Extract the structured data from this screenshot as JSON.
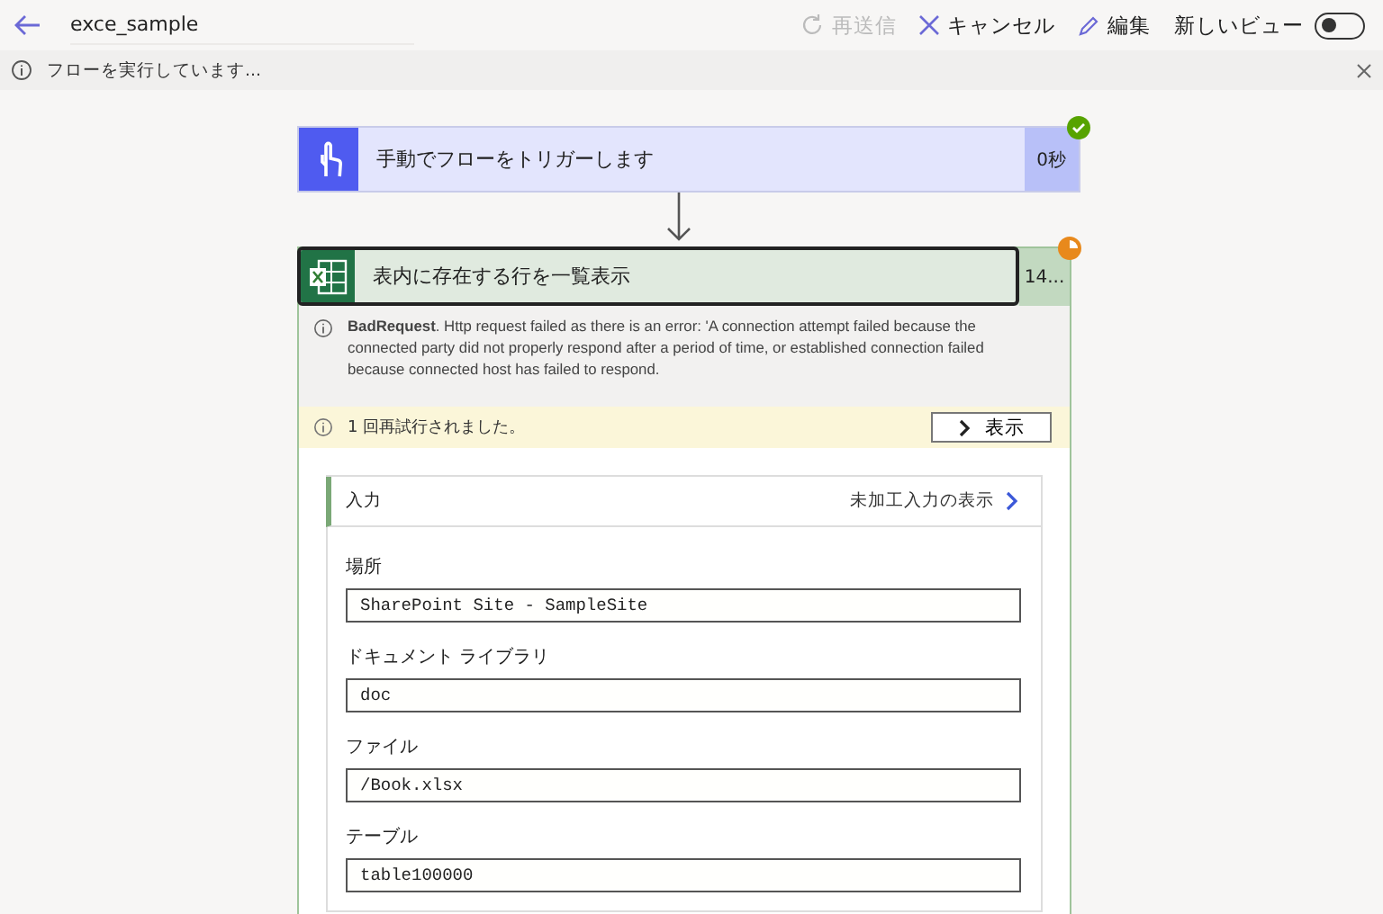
{
  "header": {
    "title": "exce_sample",
    "actions": [
      {
        "kind": "resend",
        "label": "再送信",
        "disabled": true
      },
      {
        "kind": "cancel",
        "label": "キャンセル",
        "disabled": false
      },
      {
        "kind": "edit",
        "label": "編集",
        "disabled": false
      }
    ],
    "new_view": {
      "label": "新しいビュー",
      "on": false
    }
  },
  "banner": {
    "message": "フローを実行しています..."
  },
  "trigger": {
    "title": "手動でフローをトリガーします",
    "duration": "0秒",
    "done": true
  },
  "action": {
    "title": "表内に存在する行を一覧表示",
    "duration": "14...",
    "done": false,
    "error": "**BadRequest**. Http request failed as there is an error: 'A connection attempt failed because the connected party did not properly respond after a period of time, or established connection failed because connected host has failed to respond.",
    "retry": {
      "message": "1 回再試行されました。",
      "button": "表示"
    },
    "inputs": {
      "title": "入力",
      "raw_link": "未加工入力の表示",
      "fields": [
        {
          "label": "場所",
          "value": "SharePoint Site - SampleSite"
        },
        {
          "label": "ドキュメント ライブラリ",
          "value": "doc"
        },
        {
          "label": "ファイル",
          "value": "/Book.xlsx"
        },
        {
          "label": "テーブル",
          "value": "table100000"
        }
      ]
    }
  }
}
